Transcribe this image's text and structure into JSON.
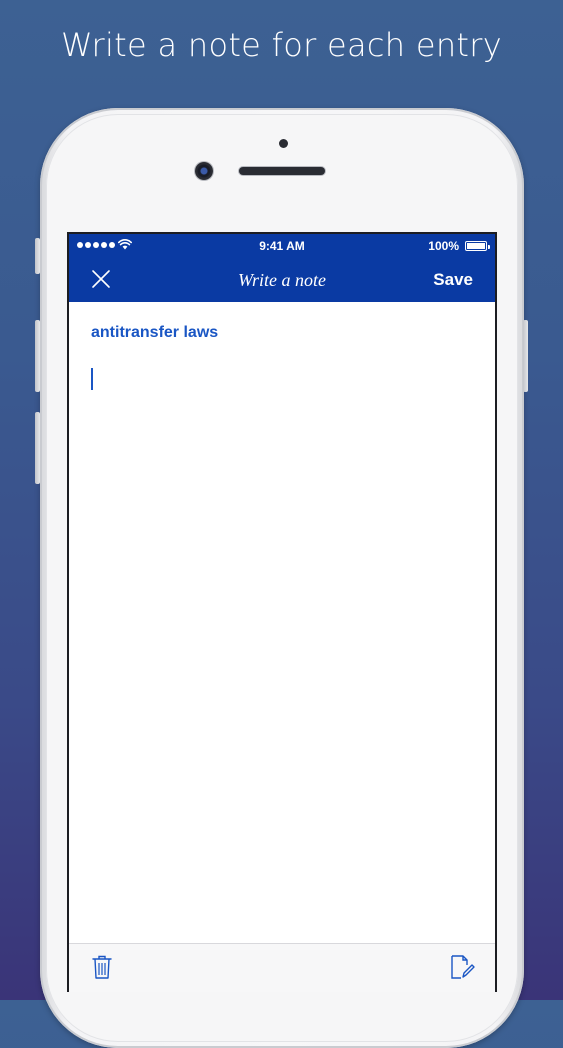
{
  "headline": "Write a note for each entry",
  "status_bar": {
    "time": "9:41 AM",
    "battery": "100%",
    "battery_level": 1.0
  },
  "navbar": {
    "title": "Write a note",
    "save_label": "Save",
    "close_icon": "close-icon"
  },
  "entry": {
    "title": "antitransfer laws"
  },
  "toolbar": {
    "trash_icon": "trash-icon",
    "compose_icon": "compose-icon"
  },
  "colors": {
    "nav_blue": "#0a3aa3",
    "accent_blue": "#1a56c4",
    "background_top": "#3d6193",
    "background_bottom": "#3a3478"
  }
}
